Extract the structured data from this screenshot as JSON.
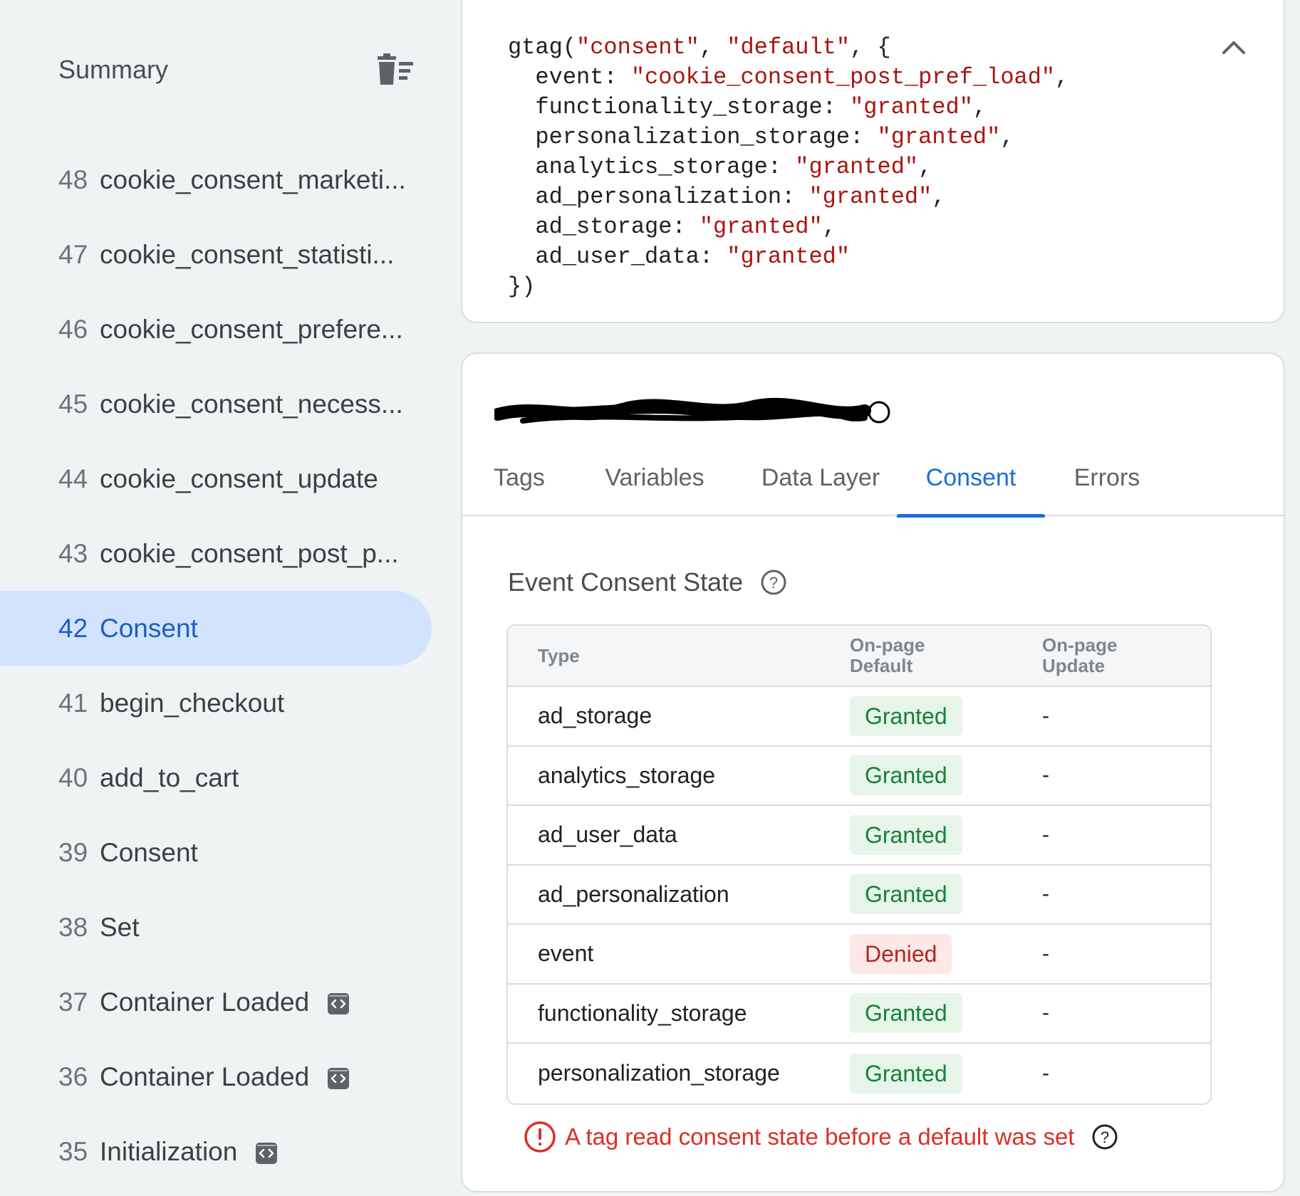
{
  "summary": {
    "title": "Summary",
    "clear_icon": "clear-list-icon"
  },
  "events": [
    {
      "num": "48",
      "name": "cookie_consent_marketi...",
      "selected": false,
      "code_badge": false
    },
    {
      "num": "47",
      "name": "cookie_consent_statisti...",
      "selected": false,
      "code_badge": false
    },
    {
      "num": "46",
      "name": "cookie_consent_prefere...",
      "selected": false,
      "code_badge": false
    },
    {
      "num": "45",
      "name": "cookie_consent_necess...",
      "selected": false,
      "code_badge": false
    },
    {
      "num": "44",
      "name": "cookie_consent_update",
      "selected": false,
      "code_badge": false
    },
    {
      "num": "43",
      "name": "cookie_consent_post_p...",
      "selected": false,
      "code_badge": false
    },
    {
      "num": "42",
      "name": "Consent",
      "selected": true,
      "code_badge": false
    },
    {
      "num": "41",
      "name": "begin_checkout",
      "selected": false,
      "code_badge": false
    },
    {
      "num": "40",
      "name": "add_to_cart",
      "selected": false,
      "code_badge": false
    },
    {
      "num": "39",
      "name": "Consent",
      "selected": false,
      "code_badge": false
    },
    {
      "num": "38",
      "name": "Set",
      "selected": false,
      "code_badge": false
    },
    {
      "num": "37",
      "name": "Container Loaded",
      "selected": false,
      "code_badge": true
    },
    {
      "num": "36",
      "name": "Container Loaded",
      "selected": false,
      "code_badge": true
    },
    {
      "num": "35",
      "name": "Initialization",
      "selected": false,
      "code_badge": true
    }
  ],
  "code": {
    "lines": [
      [
        "gtag(",
        "\"consent\"",
        ", ",
        "\"default\"",
        ", {"
      ],
      [
        "  event: ",
        "\"cookie_consent_post_pref_load\"",
        ","
      ],
      [
        "  functionality_storage: ",
        "\"granted\"",
        ","
      ],
      [
        "  personalization_storage: ",
        "\"granted\"",
        ","
      ],
      [
        "  analytics_storage: ",
        "\"granted\"",
        ","
      ],
      [
        "  ad_personalization: ",
        "\"granted\"",
        ","
      ],
      [
        "  ad_storage: ",
        "\"granted\"",
        ","
      ],
      [
        "  ad_user_data: ",
        "\"granted\""
      ],
      [
        "})"
      ]
    ],
    "collapse_icon": "chevron-up-icon"
  },
  "tabs": [
    {
      "label": "Tags",
      "active": false
    },
    {
      "label": "Variables",
      "active": false
    },
    {
      "label": "Data Layer",
      "active": false
    },
    {
      "label": "Consent",
      "active": true
    },
    {
      "label": "Errors",
      "active": false
    }
  ],
  "consent": {
    "section_title": "Event Consent State",
    "headers": {
      "type": "Type",
      "default": "On-page\nDefault",
      "update": "On-page\nUpdate"
    },
    "rows": [
      {
        "type": "ad_storage",
        "default": "Granted",
        "status": "granted",
        "update": "-"
      },
      {
        "type": "analytics_storage",
        "default": "Granted",
        "status": "granted",
        "update": "-"
      },
      {
        "type": "ad_user_data",
        "default": "Granted",
        "status": "granted",
        "update": "-"
      },
      {
        "type": "ad_personalization",
        "default": "Granted",
        "status": "granted",
        "update": "-"
      },
      {
        "type": "event",
        "default": "Denied",
        "status": "denied",
        "update": "-"
      },
      {
        "type": "functionality_storage",
        "default": "Granted",
        "status": "granted",
        "update": "-"
      },
      {
        "type": "personalization_storage",
        "default": "Granted",
        "status": "granted",
        "update": "-"
      }
    ],
    "warning": "A tag read consent state before a default was set"
  },
  "colors": {
    "accent": "#1a6ed8",
    "selected_bg": "#d3e3fd",
    "granted_bg": "#e6f4ea",
    "granted_text": "#188038",
    "denied_bg": "#fce8e6",
    "denied_text": "#b3261e",
    "warning": "#d93025",
    "code_string": "#a8150e"
  }
}
